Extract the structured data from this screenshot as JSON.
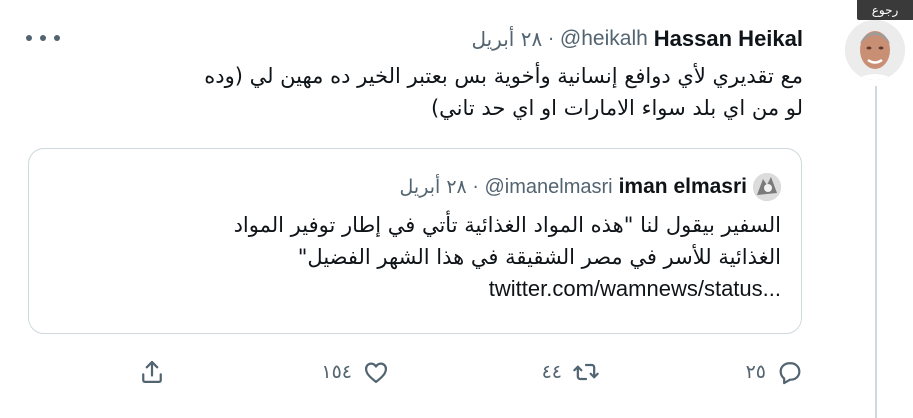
{
  "nav": {
    "back_label": "رجوع"
  },
  "tweet": {
    "author_name": "Hassan Heikal",
    "handle": "@heikalh",
    "separator": "·",
    "date": "٢٨ أبريل",
    "text_line_1": "مع تقديري لأي دوافع إنسانية وأخوية بس بعتبر الخير ده مهين لي (وده",
    "text_line_2": "لو من اي بلد سواء الامارات او اي حد تاني)"
  },
  "quoted_tweet": {
    "author_name": "iman elmasri",
    "handle": "@imanelmasri",
    "separator": "·",
    "date": "٢٨ أبريل",
    "text_line_1": "السفير بيقول لنا \"هذه المواد الغذائية تأتي في إطار توفير المواد",
    "text_line_2": "الغذائية للأسر في مصر الشقيقة في هذا الشهر الفضيل\"",
    "link": "twitter.com/wamnews/status..."
  },
  "actions": {
    "reply_count": "٢٥",
    "retweet_count": "٤٤",
    "like_count": "١٥٤",
    "icons": [
      "reply-icon",
      "retweet-icon",
      "like-icon",
      "share-icon"
    ]
  },
  "colors": {
    "text_primary": "#0f1419",
    "text_secondary": "#536471",
    "border": "#cfd9de"
  }
}
